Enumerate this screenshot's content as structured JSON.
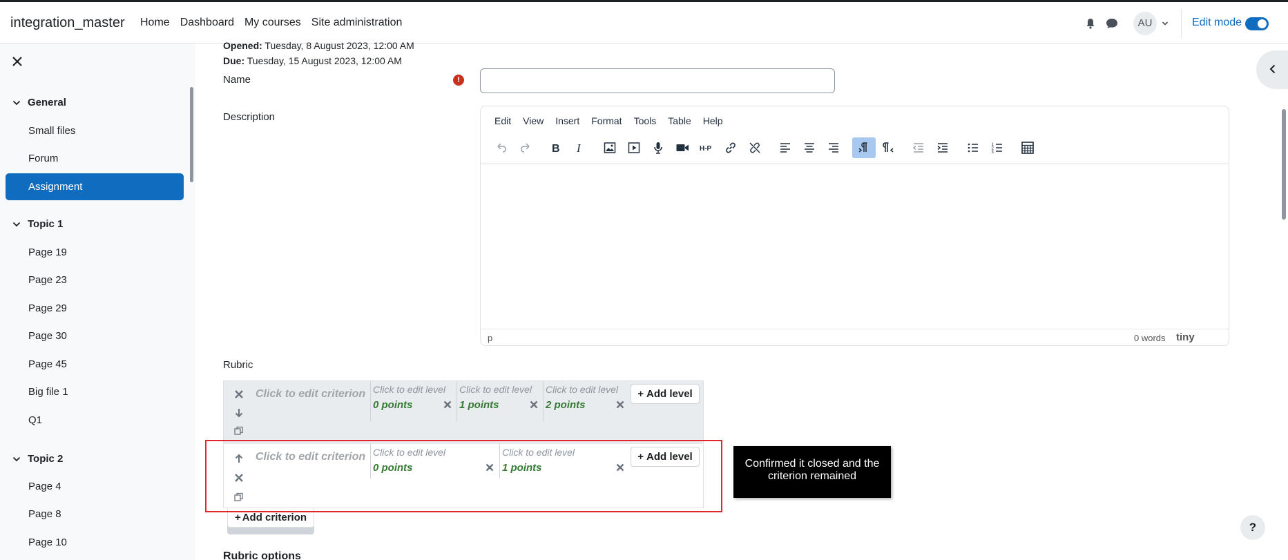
{
  "navbar": {
    "brand": "integration_master",
    "links": [
      "Home",
      "Dashboard",
      "My courses",
      "Site administration"
    ],
    "avatar": "AU",
    "edit_mode_label": "Edit mode",
    "edit_mode_on": true
  },
  "drawer": {
    "sections": [
      {
        "title": "General",
        "items": [
          "Small files",
          "Forum",
          "Assignment"
        ]
      },
      {
        "title": "Topic 1",
        "items": [
          "Page 19",
          "Page 23",
          "Page 29",
          "Page 30",
          "Page 45",
          "Big file 1",
          "Q1"
        ]
      },
      {
        "title": "Topic 2",
        "items": [
          "Page 4",
          "Page 8",
          "Page 10"
        ]
      }
    ],
    "active_item": "Assignment"
  },
  "main": {
    "opened_label": "Opened:",
    "opened_value": "Tuesday, 8 August 2023, 12:00 AM",
    "due_label": "Due:",
    "due_value": "Tuesday, 15 August 2023, 12:00 AM",
    "name_label": "Name",
    "name_value": "",
    "description_label": "Description",
    "rubric_label": "Rubric",
    "rubric_options_label": "Rubric options"
  },
  "editor": {
    "menu": [
      "Edit",
      "View",
      "Insert",
      "Format",
      "Tools",
      "Table",
      "Help"
    ],
    "status_path": "p",
    "word_count": "0 words",
    "brand": "tiny"
  },
  "rubric": {
    "criteria": [
      {
        "text": "Click to edit criterion",
        "levels": [
          {
            "description": "Click to edit level",
            "points": "0 points"
          },
          {
            "description": "Click to edit level",
            "points": "1 points"
          },
          {
            "description": "Click to edit level",
            "points": "2 points"
          }
        ]
      },
      {
        "text": "Click to edit criterion",
        "levels": [
          {
            "description": "Click to edit level",
            "points": "0 points"
          },
          {
            "description": "Click to edit level",
            "points": "1 points"
          }
        ]
      }
    ],
    "add_level_label": "Add level",
    "add_criterion_label": "Add criterion"
  },
  "annotation": {
    "tooltip": "Confirmed it closed and the criterion remained"
  },
  "help_label": "?",
  "colors": {
    "accent": "#0f6cbf",
    "points": "#357a32",
    "highlight": "#e0262a"
  }
}
